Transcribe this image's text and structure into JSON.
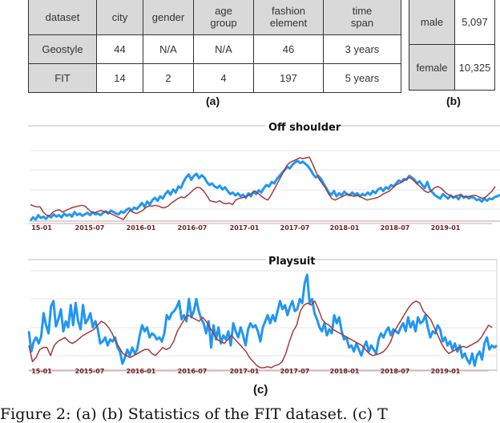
{
  "table_a": {
    "label": "(a)",
    "headers": [
      "dataset",
      "city",
      "gender",
      "age group",
      "fashion element",
      "time span"
    ],
    "rows": [
      [
        "Geostyle",
        "44",
        "N/A",
        "N/A",
        "46",
        "3 years"
      ],
      [
        "FIT",
        "14",
        "2",
        "4",
        "197",
        "5 years"
      ]
    ]
  },
  "table_b": {
    "label": "(b)",
    "rows": [
      [
        "male",
        "5,097"
      ],
      [
        "female",
        "10,325"
      ]
    ]
  },
  "figure_c_label": "(c)",
  "caption": "Figure 2: (a) (b) Statistics of the FIT dataset. (c) T",
  "colors": {
    "observed": "#2196f3",
    "predicted": "#a33a3a",
    "grid": "#e6e6e6",
    "tick_text": "#6b2222"
  },
  "chart_data": [
    {
      "type": "line",
      "title": "Off shoulder",
      "xlabel": "",
      "ylabel": "",
      "x_ticks": [
        "15-01",
        "2015-07",
        "2016-01",
        "2016-07",
        "2017-01",
        "2017-07",
        "2018-01",
        "2018-07",
        "2019-01"
      ],
      "x_range": [
        "2014-12",
        "2019-08"
      ],
      "ylim": [
        0,
        1
      ],
      "grid": true,
      "legend": "none",
      "series": [
        {
          "name": "observed",
          "color": "#2196f3",
          "values": [
            0.01,
            0.05,
            0.02,
            0.08,
            0.04,
            0.06,
            0.03,
            0.07,
            0.05,
            0.09,
            0.06,
            0.08,
            0.05,
            0.1,
            0.07,
            0.09,
            0.06,
            0.12,
            0.08,
            0.1,
            0.07,
            0.09,
            0.11,
            0.08,
            0.12,
            0.09,
            0.1,
            0.08,
            0.11,
            0.13,
            0.1,
            0.14,
            0.12,
            0.1,
            0.09,
            0.13,
            0.11,
            0.15,
            0.17,
            0.14,
            0.18,
            0.16,
            0.2,
            0.24,
            0.19,
            0.26,
            0.22,
            0.28,
            0.31,
            0.27,
            0.33,
            0.3,
            0.36,
            0.4,
            0.35,
            0.42,
            0.38,
            0.46,
            0.44,
            0.52,
            0.58,
            0.62,
            0.55,
            0.6,
            0.63,
            0.57,
            0.61,
            0.58,
            0.52,
            0.48,
            0.5,
            0.46,
            0.44,
            0.47,
            0.42,
            0.45,
            0.4,
            0.36,
            0.38,
            0.34,
            0.37,
            0.33,
            0.35,
            0.31,
            0.37,
            0.33,
            0.39,
            0.36,
            0.41,
            0.38,
            0.44,
            0.48,
            0.46,
            0.52,
            0.5,
            0.56,
            0.6,
            0.64,
            0.68,
            0.72,
            0.7,
            0.75,
            0.78,
            0.8,
            0.77,
            0.79,
            0.76,
            0.73,
            0.68,
            0.62,
            0.58,
            0.6,
            0.56,
            0.5,
            0.44,
            0.38,
            0.35,
            0.4,
            0.33,
            0.37,
            0.34,
            0.39,
            0.36,
            0.34,
            0.38,
            0.35,
            0.37,
            0.33,
            0.36,
            0.34,
            0.38,
            0.35,
            0.4,
            0.37,
            0.42,
            0.44,
            0.4,
            0.45,
            0.43,
            0.48,
            0.46,
            0.5,
            0.54,
            0.52,
            0.56,
            0.55,
            0.6,
            0.58,
            0.55,
            0.5,
            0.53,
            0.48,
            0.44,
            0.52,
            0.42,
            0.38,
            0.34,
            0.32,
            0.3,
            0.36,
            0.33,
            0.3,
            0.34,
            0.31,
            0.33,
            0.29,
            0.35,
            0.31,
            0.33,
            0.3,
            0.32,
            0.31,
            0.28,
            0.29,
            0.26,
            0.3,
            0.27,
            0.3,
            0.29,
            0.32,
            0.33,
            0.35
          ]
        },
        {
          "name": "predicted",
          "color": "#a33a3a",
          "values": [
            0.22,
            0.2,
            0.19,
            0.19,
            0.12,
            0.08,
            0.07,
            0.12,
            0.14,
            0.15,
            0.12,
            0.14,
            0.16,
            0.18,
            0.19,
            0.2,
            0.21,
            0.2,
            0.16,
            0.12,
            0.11,
            0.13,
            0.14,
            0.13,
            0.12,
            0.1,
            0.08,
            0.06,
            0.04,
            0.02,
            0.08,
            0.14,
            0.12,
            0.1,
            0.12,
            0.14,
            0.18,
            0.2,
            0.2,
            0.21,
            0.2,
            0.18,
            0.18,
            0.2,
            0.24,
            0.27,
            0.3,
            0.32,
            0.31,
            0.34,
            0.38,
            0.42,
            0.45,
            0.44,
            0.4,
            0.34,
            0.27,
            0.26,
            0.25,
            0.27,
            0.24,
            0.23,
            0.24,
            0.22,
            0.28,
            0.3,
            0.31,
            0.32,
            0.34,
            0.37,
            0.4,
            0.37,
            0.33,
            0.3,
            0.28,
            0.34,
            0.42,
            0.5,
            0.58,
            0.66,
            0.74,
            0.78,
            0.8,
            0.82,
            0.84,
            0.83,
            0.84,
            0.85,
            0.76,
            0.66,
            0.56,
            0.5,
            0.44,
            0.36,
            0.3,
            0.28,
            0.3,
            0.32,
            0.34,
            0.36,
            0.34,
            0.33,
            0.34,
            0.32,
            0.3,
            0.28,
            0.29,
            0.3,
            0.31,
            0.33,
            0.36,
            0.38,
            0.4,
            0.44,
            0.48,
            0.5,
            0.52,
            0.55,
            0.58,
            0.56,
            0.52,
            0.48,
            0.44,
            0.4,
            0.38,
            0.4,
            0.44,
            0.46,
            0.44,
            0.4,
            0.36,
            0.34,
            0.32,
            0.34,
            0.35,
            0.33,
            0.32,
            0.33,
            0.34,
            0.34,
            0.32,
            0.3,
            0.32,
            0.36,
            0.4,
            0.46
          ]
        }
      ]
    },
    {
      "type": "line",
      "title": "Playsuit",
      "xlabel": "",
      "ylabel": "",
      "x_ticks": [
        "15-01",
        "2015-07",
        "2016-01",
        "2016-07",
        "2017-01",
        "2017-07",
        "2018-01",
        "2018-07",
        "2019-01"
      ],
      "x_range": [
        "2014-12",
        "2019-08"
      ],
      "ylim": [
        0,
        1
      ],
      "grid": true,
      "legend": "none",
      "series": [
        {
          "name": "observed",
          "color": "#2196f3",
          "values": [
            0.4,
            0.2,
            0.3,
            0.34,
            0.28,
            0.35,
            0.58,
            0.46,
            0.38,
            0.65,
            0.7,
            0.45,
            0.52,
            0.62,
            0.4,
            0.5,
            0.44,
            0.66,
            0.46,
            0.68,
            0.5,
            0.42,
            0.66,
            0.48,
            0.52,
            0.58,
            0.44,
            0.5,
            0.42,
            0.28,
            0.3,
            0.34,
            0.26,
            0.32,
            0.3,
            0.34,
            0.24,
            0.2,
            0.08,
            0.14,
            0.22,
            0.16,
            0.24,
            0.18,
            0.22,
            0.36,
            0.46,
            0.4,
            0.44,
            0.34,
            0.38,
            0.36,
            0.32,
            0.34,
            0.3,
            0.38,
            0.56,
            0.52,
            0.58,
            0.6,
            0.64,
            0.7,
            0.52,
            0.56,
            0.5,
            0.72,
            0.54,
            0.6,
            0.72,
            0.6,
            0.52,
            0.48,
            0.38,
            0.5,
            0.24,
            0.46,
            0.32,
            0.44,
            0.28,
            0.36,
            0.32,
            0.4,
            0.26,
            0.48,
            0.4,
            0.34,
            0.44,
            0.36,
            0.26,
            0.42,
            0.48,
            0.44,
            0.46,
            0.4,
            0.3,
            0.44,
            0.5,
            0.56,
            0.48,
            0.56,
            0.5,
            0.6,
            0.7,
            0.62,
            0.66,
            0.56,
            0.64,
            0.7,
            0.6,
            0.62,
            0.72,
            0.68,
            0.88,
            0.96,
            0.68,
            0.72,
            0.58,
            0.52,
            0.44,
            0.4,
            0.48,
            0.36,
            0.42,
            0.38,
            0.56,
            0.48,
            0.54,
            0.4,
            0.32,
            0.34,
            0.24,
            0.26,
            0.2,
            0.28,
            0.22,
            0.16,
            0.24,
            0.3,
            0.2,
            0.26,
            0.22,
            0.18,
            0.32,
            0.38,
            0.34,
            0.4,
            0.44,
            0.36,
            0.42,
            0.4,
            0.38,
            0.44,
            0.48,
            0.4,
            0.54,
            0.44,
            0.5,
            0.4,
            0.54,
            0.48,
            0.5,
            0.56,
            0.44,
            0.34,
            0.4,
            0.38,
            0.46,
            0.42,
            0.3,
            0.34,
            0.26,
            0.3,
            0.22,
            0.28,
            0.2,
            0.26,
            0.14,
            0.18,
            0.12,
            0.08,
            0.18,
            0.06,
            0.16,
            0.2,
            0.12,
            0.28,
            0.34,
            0.22,
            0.26,
            0.24,
            0.26
          ]
        },
        {
          "name": "predicted",
          "color": "#a33a3a",
          "values": [
            0.26,
            0.1,
            0.14,
            0.22,
            0.24,
            0.24,
            0.16,
            0.26,
            0.3,
            0.32,
            0.34,
            0.3,
            0.28,
            0.3,
            0.33,
            0.36,
            0.38,
            0.4,
            0.42,
            0.46,
            0.5,
            0.48,
            0.44,
            0.38,
            0.3,
            0.24,
            0.18,
            0.16,
            0.14,
            0.16,
            0.18,
            0.2,
            0.22,
            0.22,
            0.18,
            0.16,
            0.2,
            0.24,
            0.22,
            0.24,
            0.3,
            0.4,
            0.46,
            0.52,
            0.56,
            0.54,
            0.52,
            0.5,
            0.54,
            0.5,
            0.44,
            0.38,
            0.32,
            0.3,
            0.28,
            0.32,
            0.36,
            0.32,
            0.28,
            0.24,
            0.2,
            0.14,
            0.1,
            0.06,
            0.04,
            0.04,
            0.05,
            0.04,
            0.06,
            0.07,
            0.1,
            0.18,
            0.3,
            0.4,
            0.46,
            0.6,
            0.66,
            0.68,
            0.66,
            0.7,
            0.62,
            0.52,
            0.48,
            0.46,
            0.42,
            0.4,
            0.38,
            0.36,
            0.34,
            0.32,
            0.3,
            0.28,
            0.26,
            0.22,
            0.18,
            0.16,
            0.17,
            0.18,
            0.2,
            0.24,
            0.3,
            0.4,
            0.46,
            0.52,
            0.58,
            0.64,
            0.68,
            0.7,
            0.68,
            0.6,
            0.56,
            0.52,
            0.44,
            0.36,
            0.28,
            0.22,
            0.18,
            0.2,
            0.22,
            0.24,
            0.25,
            0.24,
            0.26,
            0.28,
            0.3,
            0.34,
            0.4,
            0.46,
            0.44
          ]
        }
      ]
    }
  ]
}
